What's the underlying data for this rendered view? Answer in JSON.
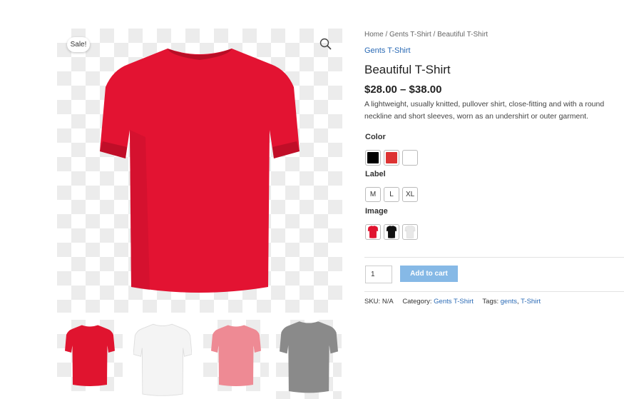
{
  "gallery": {
    "sale_badge": "Sale!",
    "zoom_icon": "magnifier-icon",
    "main_color": "#e31332",
    "thumbnails": [
      {
        "name": "red",
        "color": "#e0142f"
      },
      {
        "name": "white",
        "color": "#f4f4f4"
      },
      {
        "name": "pink",
        "color": "#ee8a94"
      },
      {
        "name": "grey",
        "color": "#8a8a8a"
      }
    ]
  },
  "breadcrumb": {
    "home": "Home",
    "sep1": " / ",
    "category": "Gents T-Shirt",
    "sep2": " / ",
    "current": "Beautiful T-Shirt"
  },
  "product": {
    "category_link": "Gents T-Shirt",
    "title": "Beautiful T-Shirt",
    "price": "$28.00 – $38.00",
    "description": "A lightweight, usually knitted, pullover shirt, close-fitting and with a round neckline and short sleeves, worn as an undershirt or outer garment."
  },
  "attributes": {
    "color": {
      "label": "Color",
      "swatches": [
        {
          "name": "black",
          "hex": "#000000"
        },
        {
          "name": "red",
          "hex": "#dd3333"
        },
        {
          "name": "white",
          "hex": "#ffffff"
        }
      ]
    },
    "size": {
      "label": "Label",
      "options": [
        "M",
        "L",
        "XL"
      ]
    },
    "image": {
      "label": "Image",
      "options": [
        {
          "name": "red",
          "hex": "#e0142f"
        },
        {
          "name": "black",
          "hex": "#111111"
        },
        {
          "name": "white",
          "hex": "#e8e8e8"
        }
      ]
    }
  },
  "cart": {
    "quantity": "1",
    "add_label": "Add to cart",
    "button_color": "#86b9e6"
  },
  "meta": {
    "sku_label": "SKU:",
    "sku_value": "N/A",
    "category_label": "Category:",
    "category_value": "Gents T-Shirt",
    "tags_label": "Tags:",
    "tag1": "gents",
    "tag_sep": ", ",
    "tag2": "T-Shirt"
  }
}
